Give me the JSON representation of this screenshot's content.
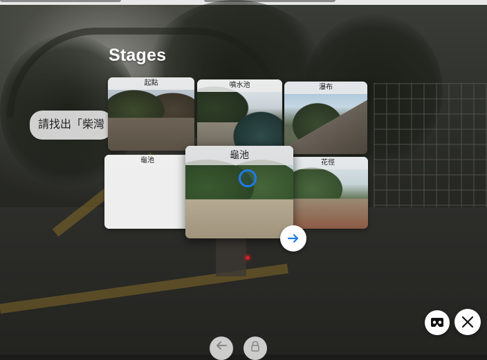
{
  "overlay": {
    "title": "Stages",
    "prompt_text": "請找出「柴灣"
  },
  "stages": [
    {
      "label": "起點",
      "photo": "photo-a"
    },
    {
      "label": "噴水池",
      "photo": "photo-b"
    },
    {
      "label": "瀑布",
      "photo": "photo-c"
    },
    {
      "label": "龜池",
      "photo": "empty"
    },
    {
      "label": "龜池",
      "photo": "photo-d",
      "selected": true
    },
    {
      "label": "花徑",
      "photo": "photo-e"
    }
  ],
  "controls": {
    "next_icon": "arrow-right-icon",
    "vr_icon": "vr-headset-icon",
    "close_icon": "close-icon",
    "back_icon": "arrow-left-icon",
    "lock_icon": "lock-icon",
    "accent_color": "#1e7be6"
  }
}
